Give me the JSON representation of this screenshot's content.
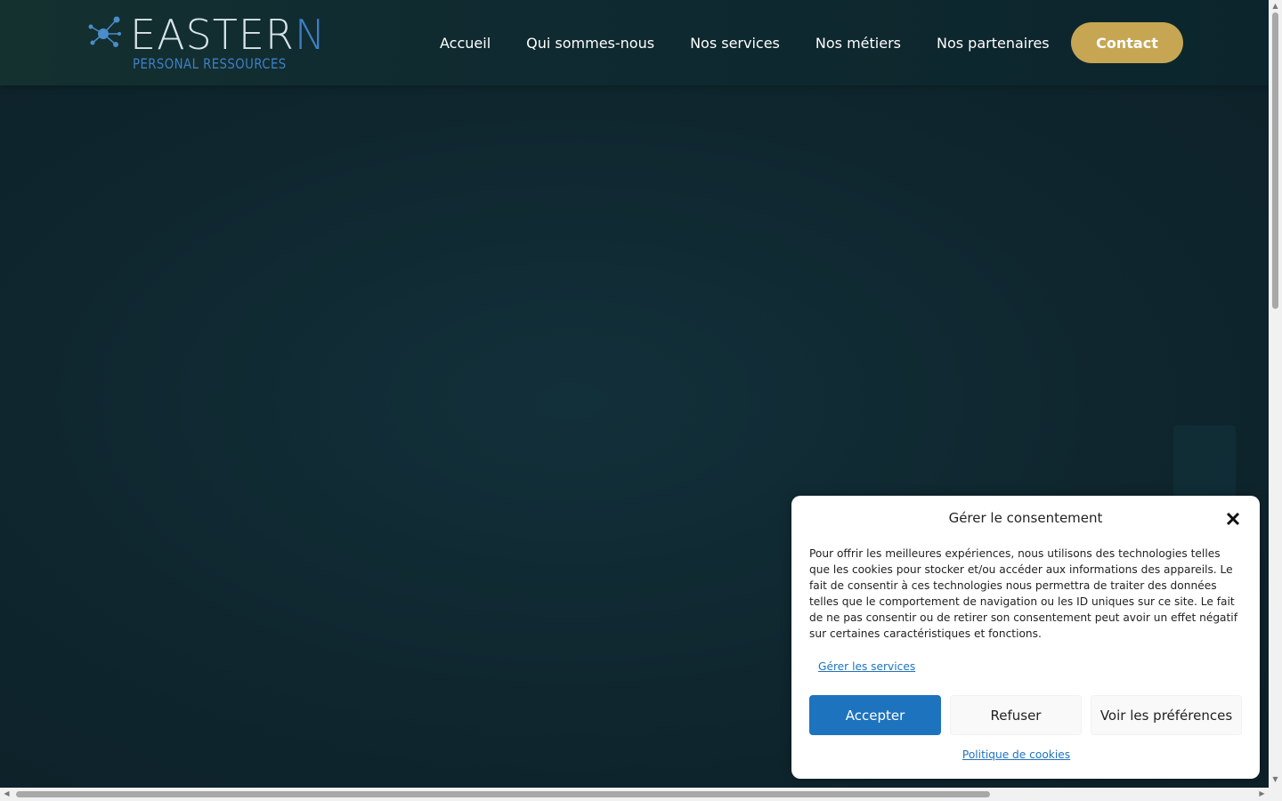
{
  "header": {
    "logo": {
      "word_main": "EASTER",
      "word_accent": "N",
      "subtitle": "PERSONAL RESSOURCES"
    },
    "nav": [
      "Accueil",
      "Qui sommes-nous",
      "Nos services",
      "Nos métiers",
      "Nos partenaires"
    ],
    "contact_label": "Contact"
  },
  "consent": {
    "title": "Gérer le consentement",
    "body": "Pour offrir les meilleures expériences, nous utilisons des technologies telles que les cookies pour stocker et/ou accéder aux informations des appareils. Le fait de consentir à ces technologies nous permettra de traiter des données telles que le comportement de navigation ou les ID uniques sur ce site. Le fait de ne pas consentir ou de retirer son consentement peut avoir un effet négatif sur certaines caractéristiques et fonctions.",
    "manage_services": "Gérer les services",
    "accept": "Accepter",
    "refuse": "Refuser",
    "preferences": "Voir les préférences",
    "policy": "Politique de cookies"
  },
  "colors": {
    "brand_gold": "#c6a653",
    "accent_blue": "#1e73be",
    "background_dark": "#102a32"
  },
  "icons": {
    "logo_mark": "molecule-icon",
    "close": "close-icon"
  }
}
